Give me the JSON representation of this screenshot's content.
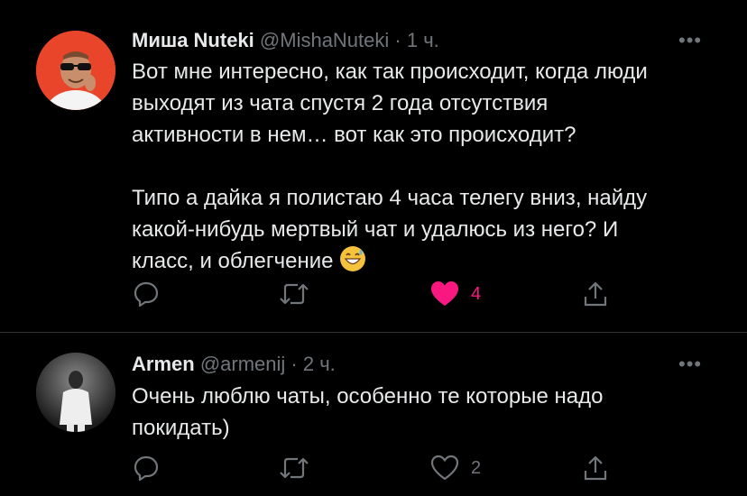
{
  "tweets": [
    {
      "author_name": "Миша Nuteki",
      "handle": "@MishaNuteki",
      "separator": "·",
      "time": "1 ч.",
      "more": "•••",
      "paragraph1": [
        "Вот мне интересно, как так происходит, когда люди",
        "выходят из чата спустя 2 года отсутствия",
        "активности в нем… вот как это происходит?"
      ],
      "paragraph2": [
        "Типо а дайка я полистаю 4 часа телегу вниз, найду",
        "какой-нибудь мертвый чат и удалюсь из него? И",
        "класс, и облегчение"
      ],
      "emoji": "grinning-face-with-sweat",
      "actions": {
        "reply": "",
        "retweet": "",
        "like": "4",
        "liked": true,
        "share": ""
      },
      "colors": {
        "like": "#f91880",
        "avatar_bg": "#e8452a"
      }
    },
    {
      "author_name": "Armen",
      "handle": "@armenij",
      "separator": "·",
      "time": "2 ч.",
      "more": "•••",
      "paragraph1": [
        "Очень люблю чаты, особенно те которые надо",
        "покидать)"
      ],
      "actions": {
        "reply": "",
        "retweet": "",
        "like": "2",
        "liked": false,
        "share": ""
      },
      "colors": {
        "avatar_bg": "#3a3a3a"
      }
    }
  ],
  "colors": {
    "background": "#000000",
    "text": "#e7e9ea",
    "muted": "#71767b",
    "divider": "#2f3336"
  }
}
